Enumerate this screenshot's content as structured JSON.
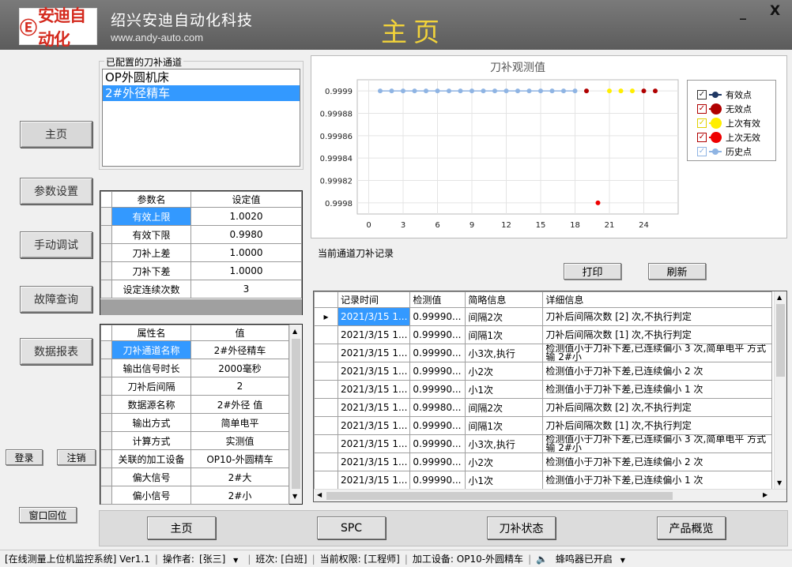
{
  "header": {
    "logo_text": "安迪自动化",
    "company": "绍兴安迪自动化科技",
    "website": "www.andy-auto.com",
    "page_title": "主页",
    "minimize": "_",
    "close": "X"
  },
  "nav": {
    "home": "主页",
    "params": "参数设置",
    "manual": "手动调试",
    "faults": "故障查询",
    "reports": "数据报表",
    "login": "登录",
    "logout": "注销",
    "reset_window": "窗口回位"
  },
  "channels": {
    "label": "已配置的刀补通道",
    "items": [
      "OP外圆机床",
      "2#外径精车"
    ],
    "selected_index": 1
  },
  "param_grid": {
    "headers": [
      "参数名",
      "设定值"
    ],
    "rows": [
      {
        "name": "有效上限",
        "value": "1.0020"
      },
      {
        "name": "有效下限",
        "value": "0.9980"
      },
      {
        "name": "刀补上差",
        "value": "1.0000"
      },
      {
        "name": "刀补下差",
        "value": "1.0000"
      },
      {
        "name": "设定连续次数",
        "value": "3"
      }
    ]
  },
  "attr_grid": {
    "headers": [
      "属性名",
      "值"
    ],
    "rows": [
      {
        "name": "刀补通道名称",
        "value": "2#外径精车"
      },
      {
        "name": "输出信号时长",
        "value": "2000毫秒"
      },
      {
        "name": "刀补后间隔",
        "value": "2"
      },
      {
        "name": "数据源名称",
        "value": "2#外径 值"
      },
      {
        "name": "输出方式",
        "value": "简单电平"
      },
      {
        "name": "计算方式",
        "value": "实测值"
      },
      {
        "name": "关联的加工设备",
        "value": "OP10-外圆精车"
      },
      {
        "name": "偏大信号",
        "value": "2#大"
      },
      {
        "name": "偏小信号",
        "value": "2#小"
      }
    ]
  },
  "chart_data": {
    "type": "scatter",
    "title": "刀补观测值",
    "xlim": [
      -1,
      27
    ],
    "ylim": [
      0.99979,
      0.99991
    ],
    "x_ticks": [
      "0",
      "3",
      "6",
      "9",
      "12",
      "15",
      "18",
      "21",
      "24"
    ],
    "y_ticks": [
      "0.9999",
      "0.99988",
      "0.99986",
      "0.99984",
      "0.99982",
      "0.9998"
    ],
    "legend_position": "right",
    "series": [
      {
        "name": "历史点",
        "color": "#8fb4e3",
        "points": [
          [
            1,
            0.9999
          ],
          [
            2,
            0.9999
          ],
          [
            3,
            0.9999
          ],
          [
            4,
            0.9999
          ],
          [
            5,
            0.9999
          ],
          [
            6,
            0.9999
          ],
          [
            7,
            0.9999
          ],
          [
            8,
            0.9999
          ],
          [
            9,
            0.9999
          ],
          [
            10,
            0.9999
          ],
          [
            11,
            0.9999
          ],
          [
            12,
            0.9999
          ],
          [
            13,
            0.9999
          ],
          [
            14,
            0.9999
          ],
          [
            15,
            0.9999
          ],
          [
            16,
            0.9999
          ],
          [
            17,
            0.9999
          ],
          [
            18,
            0.9999
          ]
        ]
      },
      {
        "name": "无效点",
        "color": "#b00000",
        "points": [
          [
            19,
            0.9999
          ],
          [
            24,
            0.9999
          ],
          [
            25,
            0.9999
          ]
        ]
      },
      {
        "name": "上次有效",
        "color": "#ffee00",
        "points": [
          [
            21,
            0.9999
          ],
          [
            22,
            0.9999
          ],
          [
            23,
            0.9999
          ]
        ]
      },
      {
        "name": "上次无效",
        "color": "#ee0000",
        "points": [
          [
            20,
            0.9998
          ]
        ]
      }
    ],
    "legend": [
      {
        "name": "有效点",
        "check": "✓",
        "color": "#1f3864",
        "cb": "#333"
      },
      {
        "name": "无效点",
        "check": "✓",
        "color": "#b00000",
        "cb": "#b00000"
      },
      {
        "name": "上次有效",
        "check": "✓",
        "color": "#ffee00",
        "cb": "#e0d000"
      },
      {
        "name": "上次无效",
        "check": "✓",
        "color": "#ee0000",
        "cb": "#b00000"
      },
      {
        "name": "历史点",
        "check": "✓",
        "color": "#8fb4e3",
        "cb": "#8fb4e3"
      }
    ]
  },
  "records": {
    "label": "当前通道刀补记录",
    "print": "打印",
    "refresh": "刷新",
    "headers": [
      "记录时间",
      "检测值",
      "简略信息",
      "详细信息"
    ],
    "rows": [
      {
        "time": "2021/3/15 1...",
        "value": "0.99990...",
        "brief": "间隔2次",
        "detail": "刀补后间隔次数 [2] 次,不执行判定"
      },
      {
        "time": "2021/3/15 1...",
        "value": "0.99990...",
        "brief": "间隔1次",
        "detail": "刀补后间隔次数 [1] 次,不执行判定"
      },
      {
        "time": "2021/3/15 1...",
        "value": "0.99990...",
        "brief": "小3次,执行",
        "detail": "检测值小于刀补下差,已连续偏小 3 次,简单电平 方式输 2#小 "
      },
      {
        "time": "2021/3/15 1...",
        "value": "0.99990...",
        "brief": "小2次",
        "detail": "检测值小于刀补下差,已连续偏小 2 次"
      },
      {
        "time": "2021/3/15 1...",
        "value": "0.99990...",
        "brief": "小1次",
        "detail": "检测值小于刀补下差,已连续偏小 1 次"
      },
      {
        "time": "2021/3/15 1...",
        "value": "0.99980...",
        "brief": "间隔2次",
        "detail": "刀补后间隔次数 [2] 次,不执行判定"
      },
      {
        "time": "2021/3/15 1...",
        "value": "0.99990...",
        "brief": "间隔1次",
        "detail": "刀补后间隔次数 [1] 次,不执行判定"
      },
      {
        "time": "2021/3/15 1...",
        "value": "0.99990...",
        "brief": "小3次,执行",
        "detail": "检测值小于刀补下差,已连续偏小 3 次,简单电平 方式输 2#小 "
      },
      {
        "time": "2021/3/15 1...",
        "value": "0.99990...",
        "brief": "小2次",
        "detail": "检测值小于刀补下差,已连续偏小 2 次"
      },
      {
        "time": "2021/3/15 1...",
        "value": "0.99990...",
        "brief": "小1次",
        "detail": "检测值小于刀补下差,已连续偏小 1 次"
      }
    ]
  },
  "bottom": {
    "home": "主页",
    "spc": "SPC",
    "status": "刀补状态",
    "overview": "产品概览"
  },
  "status_bar": {
    "system": "[在线测量上位机监控系统] Ver1.1",
    "operator_label": "操作者:",
    "operator": "[张三]",
    "shift": "班次: [白班]",
    "permission": "当前权限: [工程师]",
    "device": "加工设备: OP10-外圆精车",
    "buzzer": "蜂鸣器已开启"
  }
}
